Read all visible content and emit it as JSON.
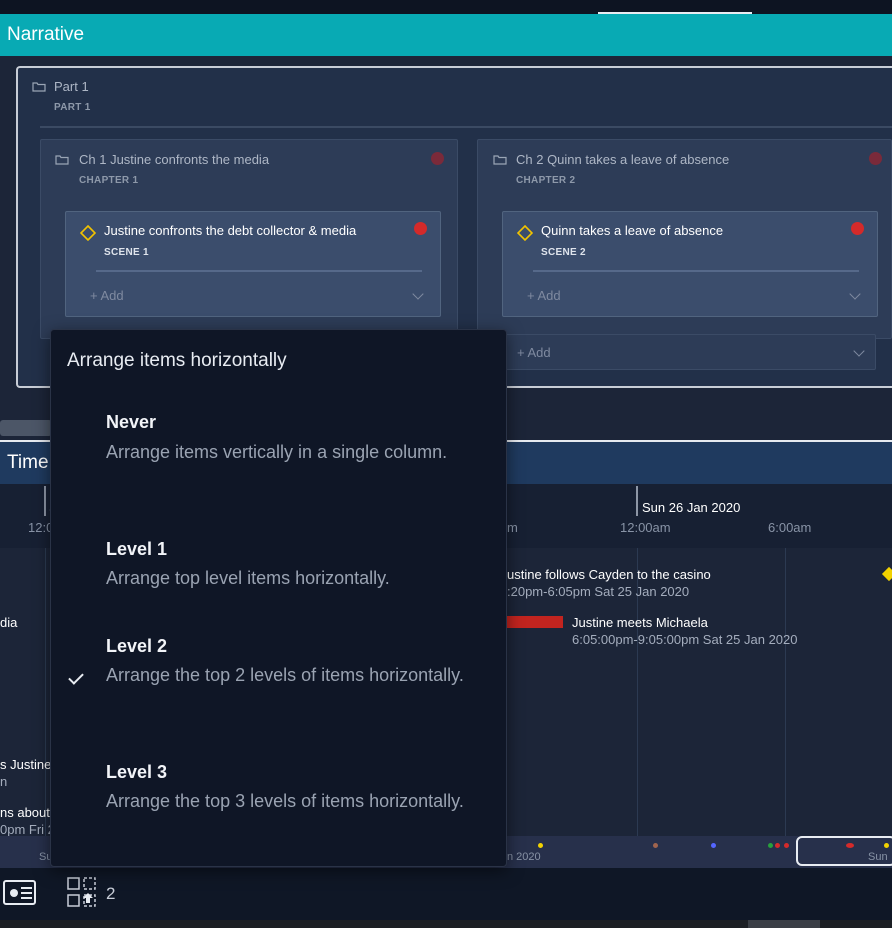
{
  "narrative": {
    "header": "Narrative",
    "part": {
      "title": "Part 1",
      "subtitle": "PART 1"
    },
    "chapters": [
      {
        "title": "Ch 1 Justine confronts the media",
        "subtitle": "CHAPTER 1",
        "scene": {
          "title": "Justine confronts the debt collector & media",
          "subtitle": "SCENE 1"
        },
        "add_label": "+ Add"
      },
      {
        "title": "Ch 2 Quinn takes a leave of absence",
        "subtitle": "CHAPTER 2",
        "scene": {
          "title": "Quinn takes a leave of absence",
          "subtitle": "SCENE 2"
        },
        "add_label": "+ Add"
      }
    ],
    "part_add_label": "+ Add"
  },
  "timeline": {
    "header": "Time",
    "date_label": "Sun 26 Jan 2020",
    "ticks": [
      "12:0",
      "m",
      "12:00am",
      "6:00am"
    ],
    "left_tick_prefix": "S",
    "events": [
      {
        "title": "ustine follows Cayden to the casino",
        "time": ":20pm-6:05pm Sat 25 Jan 2020"
      },
      {
        "title": "Justine meets Michaela",
        "time": "6:05:00pm-9:05:00pm Sat 25 Jan 2020"
      }
    ],
    "left_cut_labels": [
      "dia",
      "s Justine",
      "n",
      "ns about",
      "0pm Fri 2"
    ],
    "mini_labels": [
      "Su",
      "n 2020",
      "Sun"
    ]
  },
  "menu": {
    "title": "Arrange items horizontally",
    "options": [
      {
        "name": "Never",
        "desc": "Arrange items vertically in a single column.",
        "checked": false
      },
      {
        "name": "Level 1",
        "desc": "Arrange top level items horizontally.",
        "checked": false
      },
      {
        "name": "Level 2",
        "desc": "Arrange the top 2 levels of items horizontally.",
        "checked": true
      },
      {
        "name": "Level 3",
        "desc": "Arrange the top 3 levels of items horizontally.",
        "checked": false
      }
    ]
  },
  "bottombar": {
    "selection_count": "2"
  },
  "colors": {
    "accent_teal": "#08aab4",
    "scene_dot": "#d42a2a",
    "diamond": "#f2c300"
  }
}
